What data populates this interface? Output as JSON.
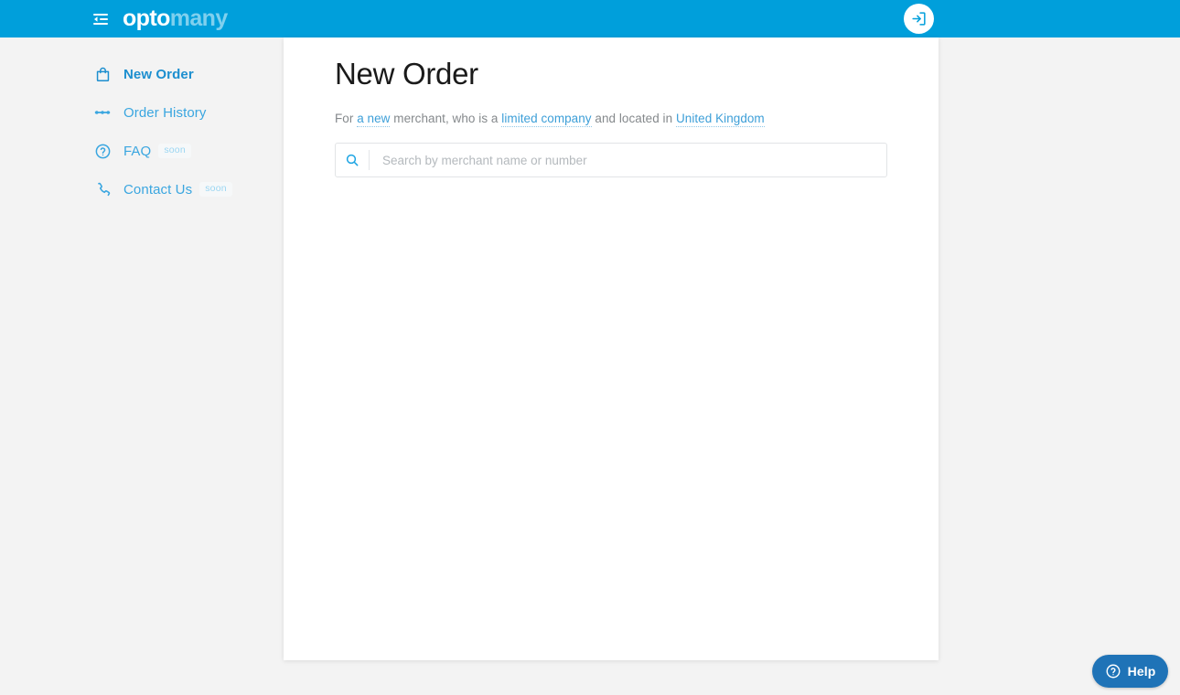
{
  "header": {
    "menu_icon": "sidebar-collapse-icon",
    "brand_primary": "opto",
    "brand_secondary": "many",
    "login_icon": "login-arrow-icon",
    "bar_color": "#009fdb"
  },
  "sidebar": {
    "items": [
      {
        "label": "New Order",
        "icon": "shopping-bag-icon",
        "active": true,
        "badge": ""
      },
      {
        "label": "Order History",
        "icon": "order-tracking-icon",
        "active": false,
        "badge": ""
      },
      {
        "label": "FAQ",
        "icon": "question-circle-icon",
        "active": false,
        "badge": "soon"
      },
      {
        "label": "Contact Us",
        "icon": "phone-icon",
        "active": false,
        "badge": "soon"
      }
    ]
  },
  "main": {
    "title": "New Order",
    "subtitle": {
      "part1": "For ",
      "link1": "a new",
      "part2": " merchant, who is a ",
      "link2": "limited company",
      "part3": " and located in ",
      "link3": "United Kingdom"
    },
    "search": {
      "placeholder": "Search by merchant name or number",
      "value": "",
      "icon": "search-icon"
    }
  },
  "help_widget": {
    "label": "Help",
    "icon": "question-circle-icon",
    "color": "#1f73b7"
  },
  "colors": {
    "brand_blue": "#009fdb",
    "brand_blue_light": "#7fd0ee",
    "link_blue": "#3d9fd8",
    "page_bg": "#f3f3f3",
    "panel_bg": "#ffffff"
  }
}
